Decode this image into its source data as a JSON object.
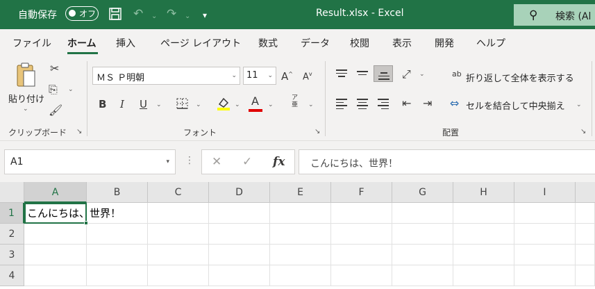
{
  "titlebar": {
    "autosave_label": "自動保存",
    "autosave_state": "オフ",
    "document_title": "Result.xlsx  -  Excel",
    "search_label": "検索 (Al"
  },
  "tabs": [
    {
      "label": "ファイル",
      "active": false
    },
    {
      "label": "ホーム",
      "active": true
    },
    {
      "label": "挿入",
      "active": false
    },
    {
      "label": "ページ レイアウト",
      "active": false
    },
    {
      "label": "数式",
      "active": false
    },
    {
      "label": "データ",
      "active": false
    },
    {
      "label": "校閲",
      "active": false
    },
    {
      "label": "表示",
      "active": false
    },
    {
      "label": "開発",
      "active": false
    },
    {
      "label": "ヘルプ",
      "active": false
    }
  ],
  "ribbon": {
    "clipboard": {
      "paste_label": "貼り付け",
      "group_label": "クリップボード"
    },
    "font": {
      "font_name": "ＭＳ Ｐ明朝",
      "font_size": "11",
      "bold": "B",
      "italic": "I",
      "underline": "U",
      "font_color_letter": "A",
      "phonetic_top": "ア",
      "phonetic_bottom": "亜",
      "group_label": "フォント",
      "highlight_color": "#ffff00",
      "font_color": "#e00000"
    },
    "alignment": {
      "wrap_text": "折り返して全体を表示する",
      "merge_center": "セルを結合して中央揃え",
      "wrap_icon_text": "ab",
      "group_label": "配置"
    }
  },
  "formula_bar": {
    "name_box": "A1",
    "formula": "こんにちは、世界！",
    "fx": "fx"
  },
  "grid": {
    "columns": [
      "A",
      "B",
      "C",
      "D",
      "E",
      "F",
      "G",
      "H",
      "I"
    ],
    "rows": [
      "1",
      "2",
      "3",
      "4"
    ],
    "selected_column": "A",
    "selected_row": "1",
    "a1_value": "こんにちは、世界！"
  },
  "colors": {
    "accent": "#217346",
    "search_bg": "#a8d2b9"
  }
}
